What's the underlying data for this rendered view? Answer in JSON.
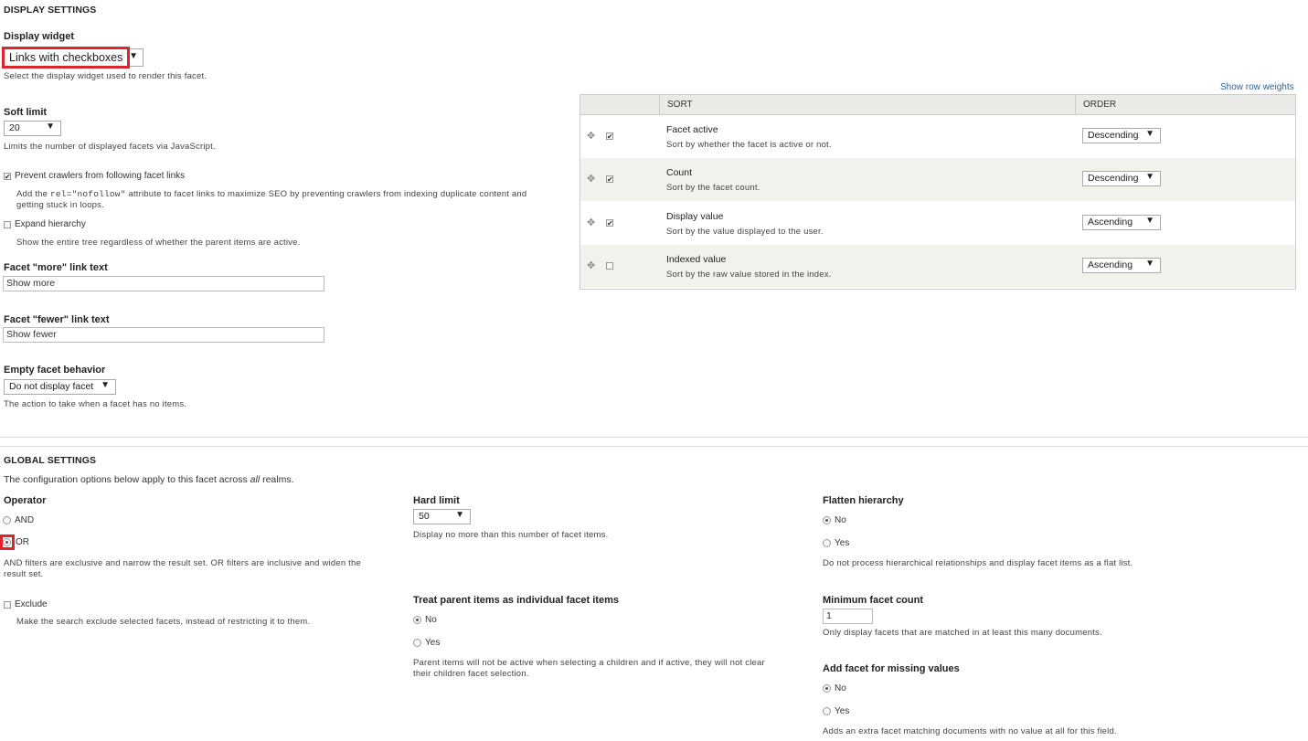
{
  "display_settings": {
    "title": "DISPLAY SETTINGS",
    "display_widget": {
      "label": "Display widget",
      "value": "Links with checkboxes",
      "description": "Select the display widget used to render this facet."
    },
    "soft_limit": {
      "label": "Soft limit",
      "value": "20",
      "description": "Limits the number of displayed facets via JavaScript."
    },
    "prevent_crawlers": {
      "label": "Prevent crawlers from following facet links",
      "checked": true,
      "description_before": "Add the ",
      "description_code": "rel=\"nofollow\"",
      "description_after": " attribute to facet links to maximize SEO by preventing crawlers from indexing duplicate content and",
      "description_line2": "getting stuck in loops."
    },
    "expand_hierarchy": {
      "label": "Expand hierarchy",
      "checked": false,
      "description": "Show the entire tree regardless of whether the parent items are active."
    },
    "more_link": {
      "label": "Facet \"more\" link text",
      "value": "Show more"
    },
    "fewer_link": {
      "label": "Facet \"fewer\" link text",
      "value": "Show fewer"
    },
    "empty_behavior": {
      "label": "Empty facet behavior",
      "value": "Do not display facet",
      "description": "The action to take when a facet has no items."
    },
    "show_row_weights": "Show row weights",
    "sort_table": {
      "headers": {
        "sort": "SORT",
        "order": "ORDER"
      },
      "rows": [
        {
          "title": "Facet active",
          "description": "Sort by whether the facet is active or not.",
          "checked": true,
          "order": "Descending"
        },
        {
          "title": "Count",
          "description": "Sort by the facet count.",
          "checked": true,
          "order": "Descending"
        },
        {
          "title": "Display value",
          "description": "Sort by the value displayed to the user.",
          "checked": true,
          "order": "Ascending"
        },
        {
          "title": "Indexed value",
          "description": "Sort by the raw value stored in the index.",
          "checked": false,
          "order": "Ascending"
        }
      ]
    }
  },
  "global_settings": {
    "title": "GLOBAL SETTINGS",
    "intro_before": "The configuration options below apply to this facet across ",
    "intro_em": "all",
    "intro_after": " realms.",
    "operator": {
      "label": "Operator",
      "options": [
        "AND",
        "OR"
      ],
      "selected": "OR",
      "description_line1": "AND filters are exclusive and narrow the result set. OR filters are inclusive and widen the",
      "description_line2": "result set."
    },
    "exclude": {
      "label": "Exclude",
      "checked": false,
      "description": "Make the search exclude selected facets, instead of restricting it to them."
    },
    "hard_limit": {
      "label": "Hard limit",
      "value": "50",
      "description": "Display no more than this number of facet items."
    },
    "treat_parent": {
      "label": "Treat parent items as individual facet items",
      "options": [
        "No",
        "Yes"
      ],
      "selected": "No",
      "description_line1": "Parent items will not be active when selecting a children and if active, they will not clear",
      "description_line2": "their children facet selection."
    },
    "flatten": {
      "label": "Flatten hierarchy",
      "options": [
        "No",
        "Yes"
      ],
      "selected": "No",
      "description": "Do not process hierarchical relationships and display facet items as a flat list."
    },
    "min_count": {
      "label": "Minimum facet count",
      "value": "1",
      "description": "Only display facets that are matched in at least this many documents."
    },
    "missing": {
      "label": "Add facet for missing values",
      "options": [
        "No",
        "Yes"
      ],
      "selected": "No",
      "description": "Adds an extra facet matching documents with no value at all for this field."
    }
  },
  "colors": {
    "highlight": "#d9262f",
    "link": "#2a6496",
    "table_header": "#eaeae6",
    "row_alt": "#f2f2ed"
  }
}
